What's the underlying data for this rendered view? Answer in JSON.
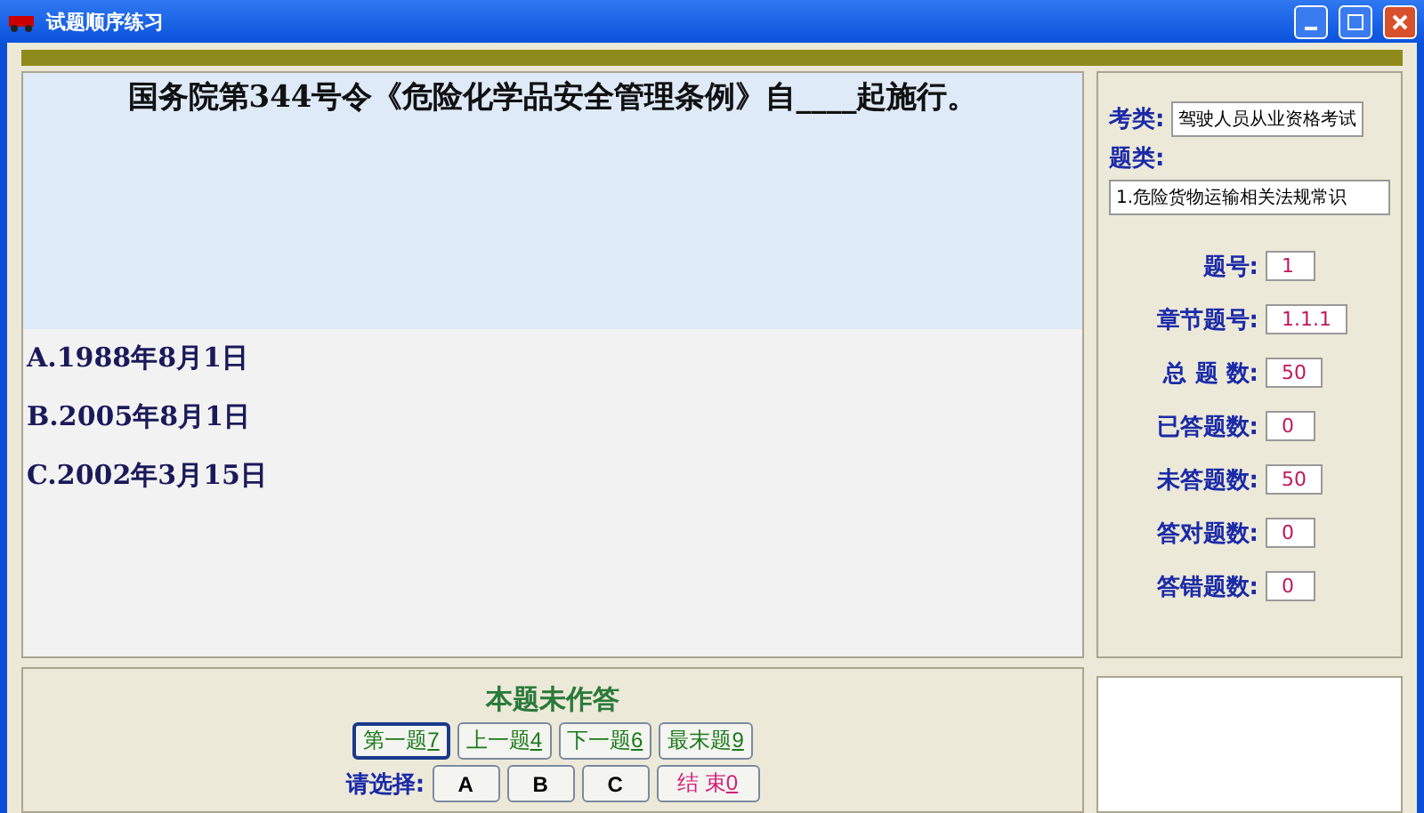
{
  "window": {
    "title": "试题顺序练习"
  },
  "question": {
    "text": "国务院第344号令《危险化学品安全管理条例》自____起施行。",
    "options": [
      "A.1988年8月1日",
      "B.2005年8月1日",
      "C.2002年3月15日"
    ]
  },
  "info": {
    "exam_label": "考类:",
    "exam_value": "驾驶人员从业资格考试",
    "category_label": "题类:",
    "category_value": "1.危险货物运输相关法规常识",
    "fields": [
      {
        "label": "题号:",
        "value": "1"
      },
      {
        "label": "章节题号:",
        "value": "1.1.1"
      },
      {
        "label": "总 题 数:",
        "value": "50"
      },
      {
        "label": "已答题数:",
        "value": "0"
      },
      {
        "label": "未答题数:",
        "value": "50"
      },
      {
        "label": "答对题数:",
        "value": "0"
      },
      {
        "label": "答错题数:",
        "value": "0"
      }
    ]
  },
  "status": "本题未作答",
  "nav_buttons": [
    {
      "label": "第一题",
      "key": "7",
      "selected": true
    },
    {
      "label": "上一题",
      "key": "4",
      "selected": false
    },
    {
      "label": "下一题",
      "key": "6",
      "selected": false
    },
    {
      "label": "最末题",
      "key": "9",
      "selected": false
    }
  ],
  "choose_label": "请选择:",
  "answer_buttons": [
    "A",
    "B",
    "C"
  ],
  "end_button": {
    "label": "结 束",
    "key": "0"
  }
}
